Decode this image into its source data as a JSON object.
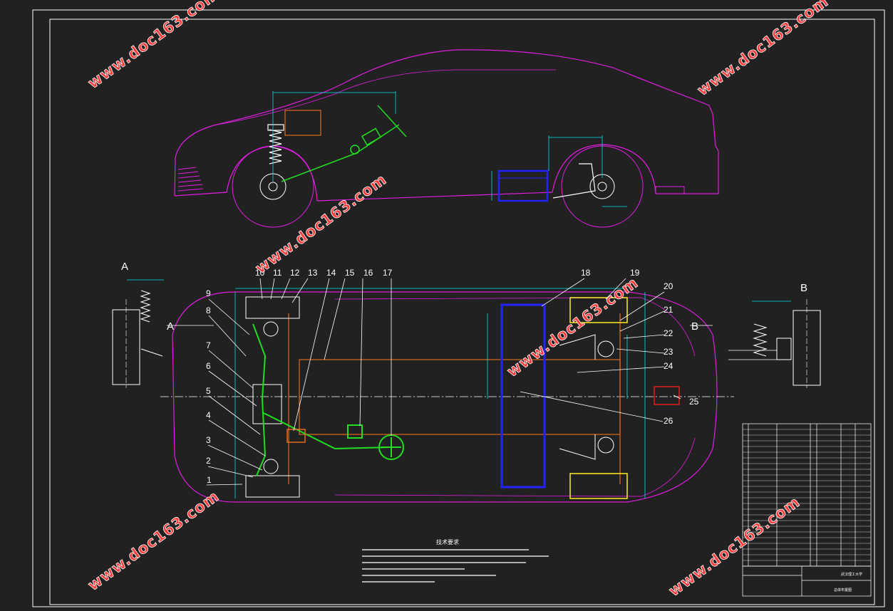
{
  "callouts": [
    "1",
    "2",
    "3",
    "4",
    "5",
    "6",
    "7",
    "8",
    "9",
    "10",
    "11",
    "12",
    "13",
    "14",
    "15",
    "16",
    "17",
    "18",
    "19",
    "20",
    "21",
    "22",
    "23",
    "24",
    "25",
    "26"
  ],
  "views": {
    "a": "A",
    "b": "B"
  },
  "watermark": "www.doc163.com",
  "notes_title": "技术要求",
  "title_block": {
    "school": "武汉理工大学",
    "drawing": "总体布置图"
  },
  "colors": {
    "background": "#212121",
    "frame": "#ffffff",
    "body_outline": "#e01ee0",
    "dimension": "#00e5e5",
    "frame_rail": "#e06a1e",
    "battery": "#2222ff",
    "steering": "#22dd22",
    "brake_caliper": "#ffee22",
    "watermark": "#ff3b3b"
  }
}
